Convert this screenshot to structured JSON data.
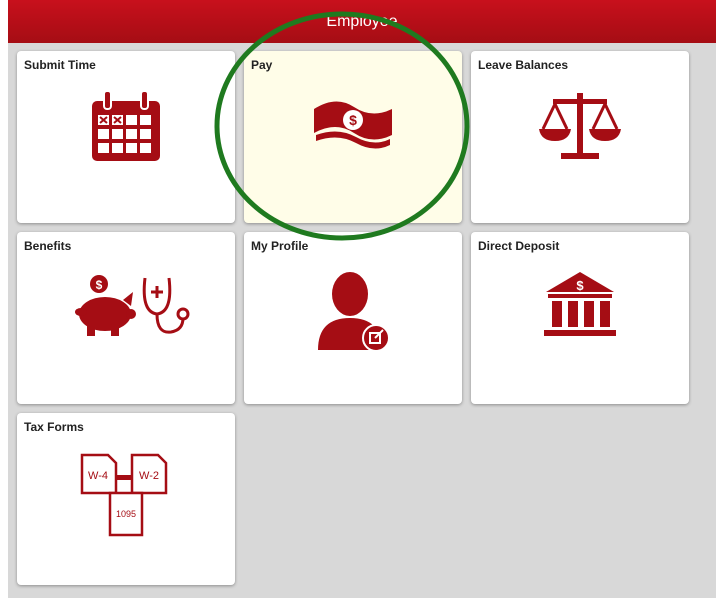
{
  "header": {
    "title": "Employee"
  },
  "tiles": [
    {
      "title": "Submit Time",
      "icon": "calendar-icon"
    },
    {
      "title": "Pay",
      "icon": "money-icon"
    },
    {
      "title": "Leave Balances",
      "icon": "scales-icon"
    },
    {
      "title": "Benefits",
      "icon": "piggy-bank-stethoscope-icon"
    },
    {
      "title": "My Profile",
      "icon": "person-icon"
    },
    {
      "title": "Direct Deposit",
      "icon": "bank-icon"
    },
    {
      "title": "Tax Forms",
      "icon": "tax-forms-icon"
    }
  ],
  "tax_forms_icon": {
    "form1": "W-4",
    "form2": "W-2",
    "form3": "1095"
  },
  "colors": {
    "brand": "#a50d14",
    "highlight_tile": "#fffde8",
    "annotation_circle": "#1f7a1f"
  }
}
